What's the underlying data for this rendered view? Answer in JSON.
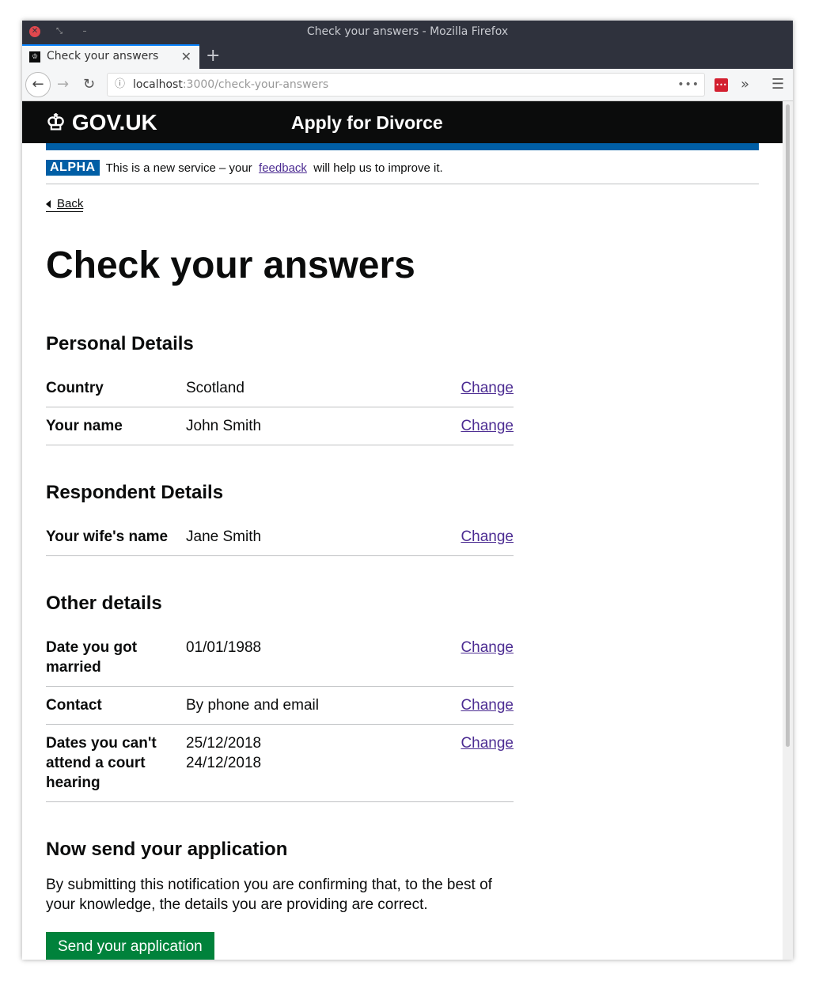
{
  "browser": {
    "window_title": "Check your answers - Mozilla Firefox",
    "tab_title": "Check your answers",
    "url_host": "localhost",
    "url_path": ":3000/check-your-answers"
  },
  "header": {
    "logo": "GOV.UK",
    "service": "Apply for Divorce"
  },
  "phase": {
    "tag": "ALPHA",
    "text_before": "This is a new service – your ",
    "link": "feedback",
    "text_after": " will help us to improve it."
  },
  "back": "Back",
  "title": "Check your answers",
  "sections": [
    {
      "heading": "Personal Details",
      "rows": [
        {
          "key": "Country",
          "value": "Scotland",
          "action": "Change"
        },
        {
          "key": "Your name",
          "value": "John Smith",
          "action": "Change"
        }
      ]
    },
    {
      "heading": "Respondent Details",
      "rows": [
        {
          "key": "Your wife's name",
          "value": "Jane Smith",
          "action": "Change"
        }
      ]
    },
    {
      "heading": "Other details",
      "rows": [
        {
          "key": "Date you got married",
          "value": "01/01/1988",
          "action": "Change"
        },
        {
          "key": "Contact",
          "value": "By phone and email",
          "action": "Change"
        },
        {
          "key": "Dates you can't attend a court hearing",
          "value": "25/12/2018\n24/12/2018",
          "action": "Change"
        }
      ]
    }
  ],
  "submit": {
    "heading": "Now send your application",
    "text": "By submitting this notification you are confirming that, to the best of your knowledge, the details you are providing are correct.",
    "button": "Send your application"
  }
}
